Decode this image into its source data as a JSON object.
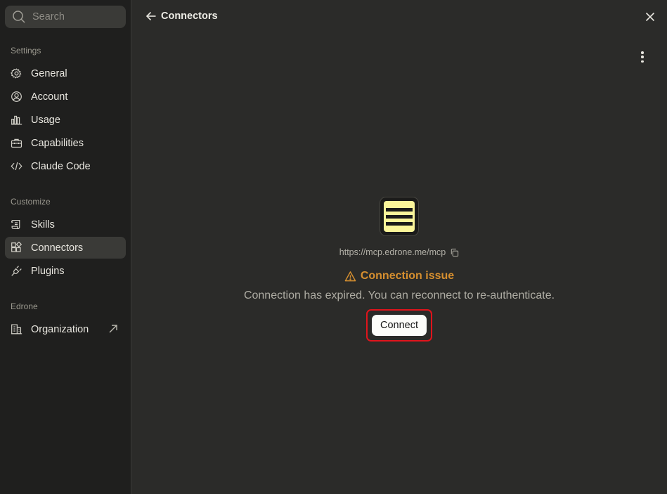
{
  "sidebar": {
    "search": {
      "placeholder": "Search"
    },
    "sections": [
      {
        "label": "Settings",
        "items": [
          {
            "label": "General",
            "icon": "gear-icon"
          },
          {
            "label": "Account",
            "icon": "user-circle-icon"
          },
          {
            "label": "Usage",
            "icon": "bar-chart-icon"
          },
          {
            "label": "Capabilities",
            "icon": "toolbox-icon"
          },
          {
            "label": "Claude Code",
            "icon": "code-icon"
          }
        ]
      },
      {
        "label": "Customize",
        "items": [
          {
            "label": "Skills",
            "icon": "scroll-icon"
          },
          {
            "label": "Connectors",
            "icon": "blocks-icon",
            "active": true
          },
          {
            "label": "Plugins",
            "icon": "plug-icon"
          }
        ]
      },
      {
        "label": "Edrone",
        "items": [
          {
            "label": "Organization",
            "icon": "building-icon",
            "external": true
          }
        ]
      }
    ]
  },
  "header": {
    "title": "Connectors"
  },
  "connector": {
    "url": "https://mcp.edrone.me/mcp",
    "status_title": "Connection issue",
    "status_message": "Connection has expired. You can reconnect to re-authenticate.",
    "connect_label": "Connect",
    "logo_color": "#faf59a"
  },
  "colors": {
    "warning": "#d68f2f",
    "highlight": "#e0141c"
  }
}
